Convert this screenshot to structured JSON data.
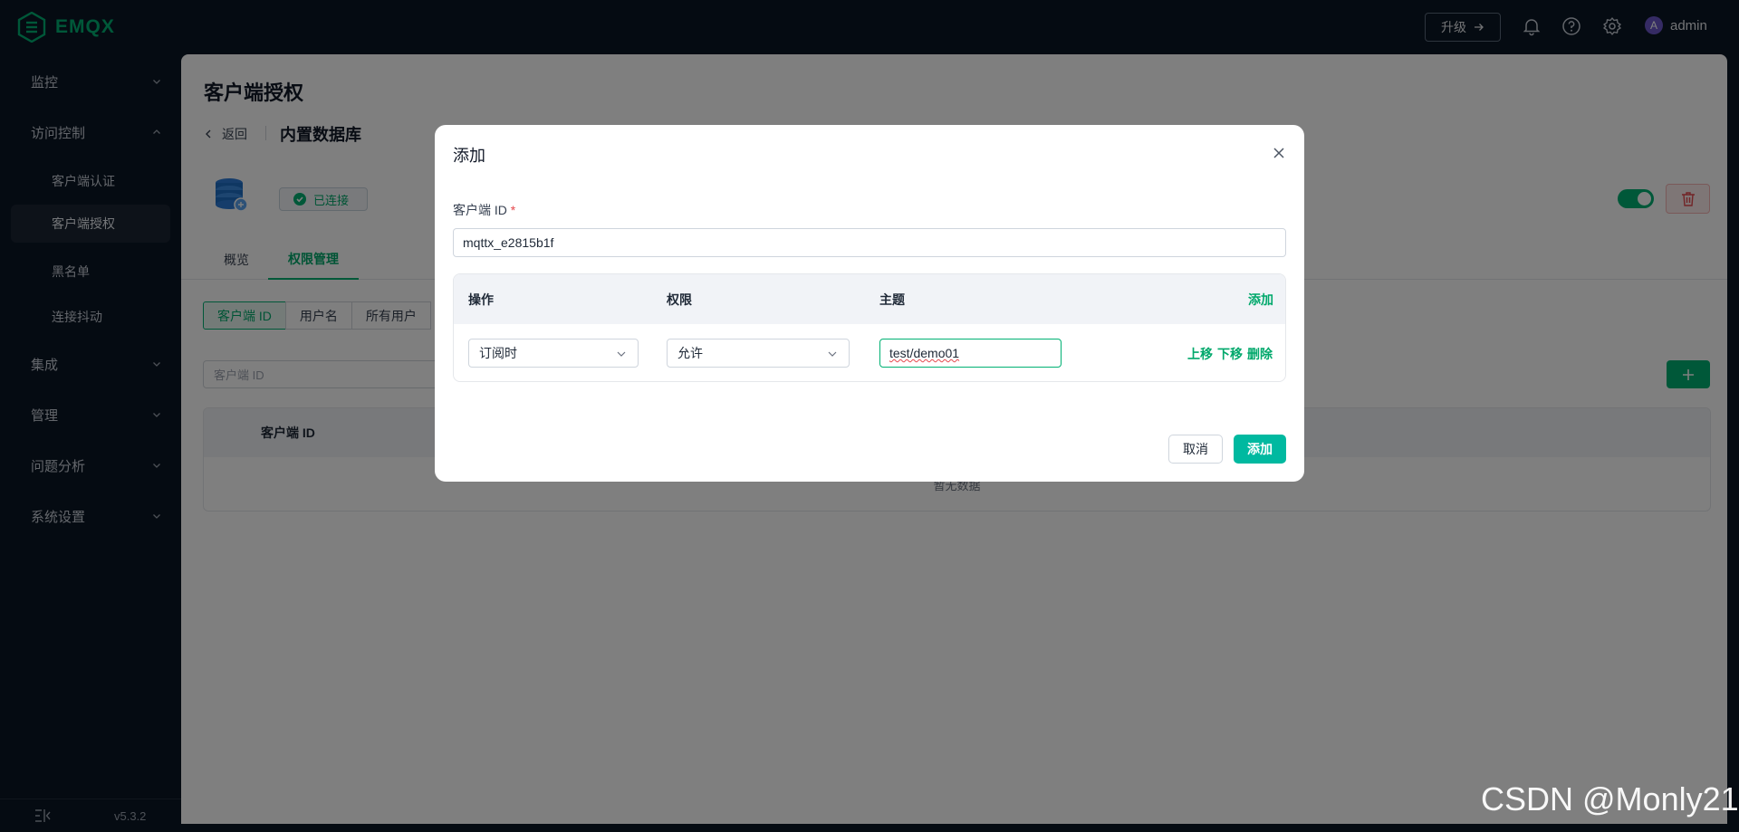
{
  "app": {
    "logo_text": "EMQX",
    "brand_color": "#00b173"
  },
  "topbar": {
    "upgrade_label": "升级",
    "icons": [
      "bell-icon",
      "help-icon",
      "gear-icon"
    ],
    "avatar_letter": "A",
    "username": "admin"
  },
  "sidebar": {
    "groups": [
      {
        "label": "监控",
        "expanded": false
      },
      {
        "label": "访问控制",
        "expanded": true,
        "items": [
          {
            "label": "客户端认证",
            "active": false
          },
          {
            "label": "客户端授权",
            "active": true
          },
          {
            "label": "黑名单",
            "active": false
          },
          {
            "label": "连接抖动",
            "active": false
          }
        ]
      },
      {
        "label": "集成",
        "expanded": false
      },
      {
        "label": "管理",
        "expanded": false
      },
      {
        "label": "问题分析",
        "expanded": false
      },
      {
        "label": "系统设置",
        "expanded": false
      }
    ],
    "version": "v5.3.2"
  },
  "main": {
    "page_title": "客户端授权",
    "back_label": "返回",
    "breadcrumb_current": "内置数据库",
    "status": "已连接",
    "enabled": true,
    "tabs": [
      {
        "label": "概览",
        "active": false
      },
      {
        "label": "权限管理",
        "active": true
      }
    ],
    "segments": [
      {
        "label": "客户端 ID",
        "active": true
      },
      {
        "label": "用户名",
        "active": false
      },
      {
        "label": "所有用户",
        "active": false
      }
    ],
    "search_placeholder": "客户端 ID",
    "table": {
      "columns": [
        "客户端 ID"
      ],
      "empty_text": "暂无数据"
    }
  },
  "dialog": {
    "title": "添加",
    "client_id_label": "客户端 ID",
    "required_mark": "*",
    "client_id_value": "mqttx_e2815b1f",
    "rules_columns": {
      "action": "操作",
      "permission": "权限",
      "topic": "主题",
      "add": "添加"
    },
    "rule": {
      "action": "订阅时",
      "permission": "允许",
      "topic": "test/demo01",
      "move_up": "上移",
      "move_down": "下移",
      "delete": "删除"
    },
    "cancel_label": "取消",
    "submit_label": "添加"
  },
  "watermark": "CSDN @Monly21"
}
